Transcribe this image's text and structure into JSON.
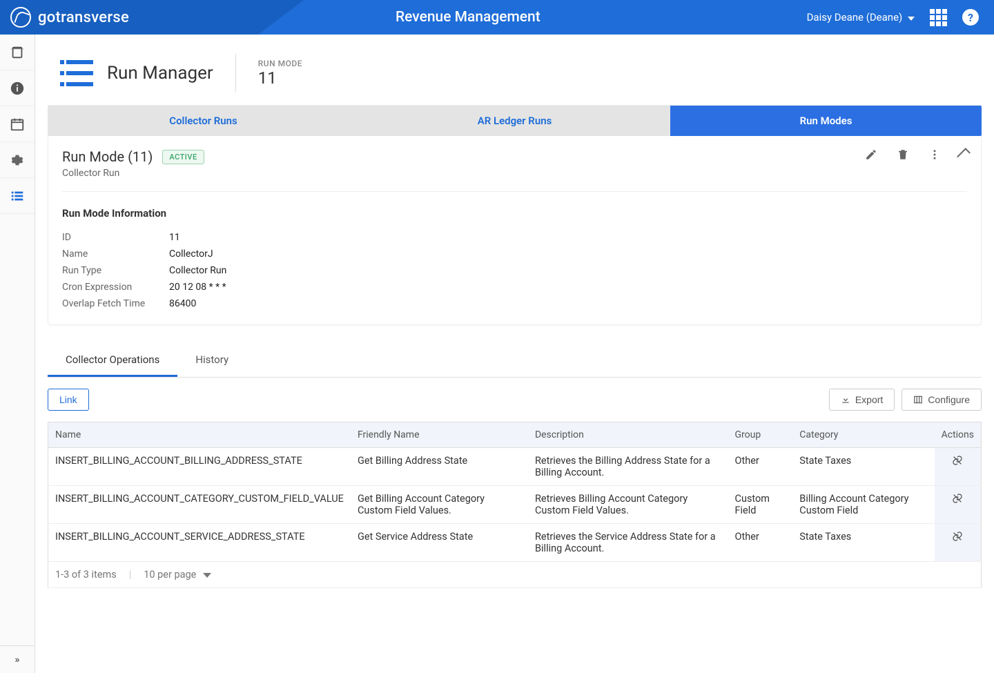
{
  "header": {
    "brand": "gotransverse",
    "title": "Revenue Management",
    "user": "Daisy Deane (Deane)"
  },
  "page": {
    "title": "Run Manager",
    "meta_label": "RUN MODE",
    "meta_value": "11"
  },
  "tabs": [
    {
      "label": "Collector Runs",
      "active": false
    },
    {
      "label": "AR Ledger Runs",
      "active": false
    },
    {
      "label": "Run Modes",
      "active": true
    }
  ],
  "panel": {
    "title": "Run Mode (11)",
    "badge": "ACTIVE",
    "subtitle": "Collector Run"
  },
  "info": {
    "section_title": "Run Mode Information",
    "rows": [
      {
        "label": "ID",
        "value": "11"
      },
      {
        "label": "Name",
        "value": "CollectorJ"
      },
      {
        "label": "Run Type",
        "value": "Collector Run"
      },
      {
        "label": "Cron Expression",
        "value": "20 12 08 * * *"
      },
      {
        "label": "Overlap Fetch Time",
        "value": "86400"
      }
    ]
  },
  "subtabs": [
    {
      "label": "Collector Operations",
      "active": true
    },
    {
      "label": "History",
      "active": false
    }
  ],
  "toolbar": {
    "link_btn": "Link",
    "export_btn": "Export",
    "configure_btn": "Configure"
  },
  "table": {
    "columns": [
      "Name",
      "Friendly Name",
      "Description",
      "Group",
      "Category",
      "Actions"
    ],
    "rows": [
      {
        "name": "INSERT_BILLING_ACCOUNT_BILLING_ADDRESS_STATE",
        "friendly": "Get Billing Address State",
        "desc": "Retrieves the Billing Address State for a Billing Account.",
        "group": "Other",
        "category": "State Taxes"
      },
      {
        "name": "INSERT_BILLING_ACCOUNT_CATEGORY_CUSTOM_FIELD_VALUE",
        "friendly": "Get Billing Account Category Custom Field Values.",
        "desc": "Retrieves Billing Account Category Custom Field Values.",
        "group": "Custom Field",
        "category": "Billing Account Category Custom Field"
      },
      {
        "name": "INSERT_BILLING_ACCOUNT_SERVICE_ADDRESS_STATE",
        "friendly": "Get Service Address State",
        "desc": "Retrieves the Service Address State for a Billing Account.",
        "group": "Other",
        "category": "State Taxes"
      }
    ],
    "footer": {
      "summary": "1-3 of 3 items",
      "per_page": "10 per page"
    }
  }
}
